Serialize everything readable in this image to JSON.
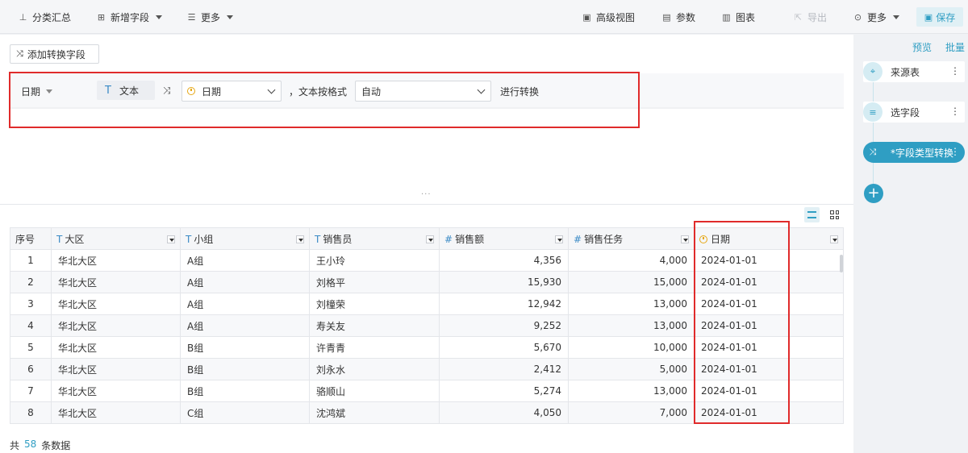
{
  "toolbar": {
    "group_summary": "分类汇总",
    "add_field": "新增字段",
    "more_left": "更多",
    "advanced_view": "高级视图",
    "params": "参数",
    "chart": "图表",
    "export": "导出",
    "more_right": "更多",
    "save": "保存"
  },
  "config": {
    "add_transform_button": "添加转换字段",
    "field_name": "日期",
    "source_type": "文本",
    "target_type": "日期",
    "format_label": "，文本按格式",
    "format_value": "自动",
    "convert_label": "进行转换"
  },
  "table": {
    "columns": [
      {
        "label": "序号",
        "type": ""
      },
      {
        "label": "大区",
        "type": "text"
      },
      {
        "label": "小组",
        "type": "text"
      },
      {
        "label": "销售员",
        "type": "text"
      },
      {
        "label": "销售额",
        "type": "number"
      },
      {
        "label": "销售任务",
        "type": "number"
      },
      {
        "label": "日期",
        "type": "date"
      }
    ],
    "rows": [
      [
        "1",
        "华北大区",
        "A组",
        "王小玲",
        "4,356",
        "4,000",
        "2024-01-01"
      ],
      [
        "2",
        "华北大区",
        "A组",
        "刘格平",
        "15,930",
        "15,000",
        "2024-01-01"
      ],
      [
        "3",
        "华北大区",
        "A组",
        "刘橦荣",
        "12,942",
        "13,000",
        "2024-01-01"
      ],
      [
        "4",
        "华北大区",
        "A组",
        "寿关友",
        "9,252",
        "13,000",
        "2024-01-01"
      ],
      [
        "5",
        "华北大区",
        "B组",
        "许青青",
        "5,670",
        "10,000",
        "2024-01-01"
      ],
      [
        "6",
        "华北大区",
        "B组",
        "刘永水",
        "2,412",
        "5,000",
        "2024-01-01"
      ],
      [
        "7",
        "华北大区",
        "B组",
        "骆顺山",
        "5,274",
        "13,000",
        "2024-01-01"
      ],
      [
        "8",
        "华北大区",
        "C组",
        "沈鸿斌",
        "4,050",
        "7,000",
        "2024-01-01"
      ]
    ]
  },
  "footer": {
    "prefix": "共",
    "count": "58",
    "suffix": "条数据"
  },
  "side_panel": {
    "preview_tab": "预览",
    "batch_tab": "批量",
    "steps": [
      {
        "label": "来源表",
        "icon": "crosshair-icon"
      },
      {
        "label": "选字段",
        "icon": "field-select-icon"
      },
      {
        "label": "*字段类型转换",
        "icon": "shuffle-icon"
      }
    ]
  },
  "colors": {
    "accent": "#2f9ec3",
    "highlight_border": "#e02b2b",
    "date_icon": "#e6a817"
  }
}
